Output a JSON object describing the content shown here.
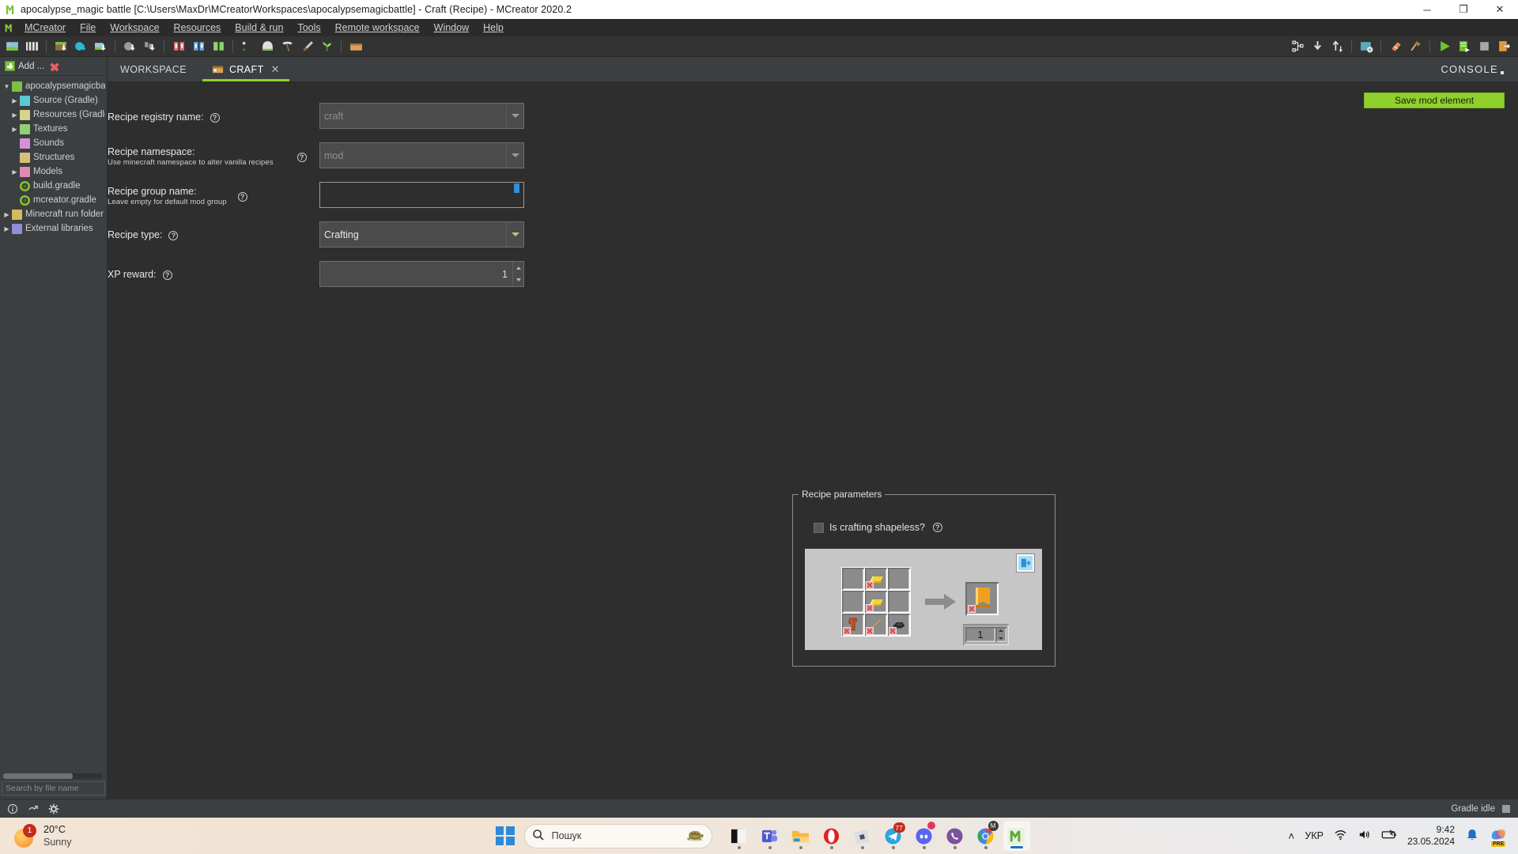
{
  "window": {
    "title": "apocalypse_magic battle [C:\\Users\\MaxDr\\MCreatorWorkspaces\\apocalypsemagicbattle] - Craft (Recipe) - MCreator 2020.2",
    "minimize": "─",
    "maximize": "❐",
    "close": "✕"
  },
  "menubar": {
    "items": [
      {
        "label": "MCreator",
        "mnemonic": "M"
      },
      {
        "label": "File",
        "mnemonic": "F"
      },
      {
        "label": "Workspace",
        "mnemonic": "W"
      },
      {
        "label": "Resources",
        "mnemonic": "R"
      },
      {
        "label": "Build & run",
        "mnemonic": "B"
      },
      {
        "label": "Tools",
        "mnemonic": "T"
      },
      {
        "label": "Remote workspace",
        "mnemonic": "R"
      },
      {
        "label": "Window",
        "mnemonic": "W"
      },
      {
        "label": "Help",
        "mnemonic": "H"
      }
    ]
  },
  "sidebar": {
    "add_label": "Add ...",
    "search_placeholder": "Search by file name",
    "tree": [
      {
        "label": "apocalypsemagicba",
        "depth": 0,
        "expandable": true,
        "expanded": true,
        "icon": "workspace-icon",
        "color": "#7cc242"
      },
      {
        "label": "Source (Gradle)",
        "depth": 1,
        "expandable": true,
        "expanded": false,
        "icon": "folder-source-icon",
        "color": "#5bc8d4"
      },
      {
        "label": "Resources (Gradle)",
        "depth": 1,
        "expandable": true,
        "expanded": false,
        "icon": "folder-resources-icon",
        "color": "#d6d38a"
      },
      {
        "label": "Textures",
        "depth": 1,
        "expandable": true,
        "expanded": false,
        "icon": "folder-textures-icon",
        "color": "#8fd170"
      },
      {
        "label": "Sounds",
        "depth": 1,
        "expandable": false,
        "expanded": false,
        "icon": "folder-sounds-icon",
        "color": "#d98fd6"
      },
      {
        "label": "Structures",
        "depth": 1,
        "expandable": false,
        "expanded": false,
        "icon": "folder-structures-icon",
        "color": "#d6c07a"
      },
      {
        "label": "Models",
        "depth": 1,
        "expandable": true,
        "expanded": false,
        "icon": "folder-models-icon",
        "color": "#e08ab4"
      },
      {
        "label": "build.gradle",
        "depth": 1,
        "expandable": false,
        "expanded": false,
        "icon": "gradle-icon",
        "color": "#8fc22a"
      },
      {
        "label": "mcreator.gradle",
        "depth": 1,
        "expandable": false,
        "expanded": false,
        "icon": "gradle-icon",
        "color": "#8fc22a"
      },
      {
        "label": "Minecraft run folder",
        "depth": 1,
        "expandable": true,
        "expanded": false,
        "icon": "folder-run-icon",
        "color": "#d6b95a"
      },
      {
        "label": "External libraries",
        "depth": 1,
        "expandable": true,
        "expanded": false,
        "icon": "folder-libs-icon",
        "color": "#8f8fd6"
      }
    ]
  },
  "tabs": {
    "items": [
      {
        "label": "WORKSPACE",
        "active": false,
        "closable": false
      },
      {
        "label": "CRAFT",
        "active": true,
        "closable": true,
        "close_glyph": "✕"
      }
    ],
    "console_label": "CONSOLE"
  },
  "main": {
    "save_label": "Save mod element",
    "help_glyph": "?",
    "fields": [
      {
        "name": "recipe-registry-name",
        "label": "Recipe registry name:",
        "sublabel": "",
        "type": "combo",
        "value": "craft",
        "disabled": true
      },
      {
        "name": "recipe-namespace",
        "label": "Recipe namespace:",
        "sublabel": "Use minecraft namespace to alter vanilla recipes",
        "type": "combo",
        "value": "mod",
        "disabled": true
      },
      {
        "name": "recipe-group-name",
        "label": "Recipe group name:",
        "sublabel": "Leave empty for default mod group",
        "type": "text",
        "value": "",
        "disabled": false
      },
      {
        "name": "recipe-type",
        "label": "Recipe type:",
        "sublabel": "",
        "type": "combo",
        "value": "Crafting",
        "disabled": false
      },
      {
        "name": "xp-reward",
        "label": "XP reward:",
        "sublabel": "",
        "type": "spinner",
        "value": "1",
        "disabled": false
      }
    ]
  },
  "recipe_parameters": {
    "group_title": "Recipe parameters",
    "shapeless_label": "Is crafting shapeless?",
    "shapeless_checked": false,
    "help_glyph": "?",
    "output_count": "1",
    "export_icon": "export-icon",
    "grid": [
      {
        "slot": 0,
        "item": "empty",
        "label": ""
      },
      {
        "slot": 1,
        "item": "gold-ingot",
        "label": "Gold Ingot"
      },
      {
        "slot": 2,
        "item": "empty",
        "label": ""
      },
      {
        "slot": 3,
        "item": "empty",
        "label": ""
      },
      {
        "slot": 4,
        "item": "gold-ingot",
        "label": "Gold Ingot"
      },
      {
        "slot": 5,
        "item": "empty",
        "label": ""
      },
      {
        "slot": 6,
        "item": "leather",
        "label": "Leather"
      },
      {
        "slot": 7,
        "item": "stick",
        "label": "Stick"
      },
      {
        "slot": 8,
        "item": "flint",
        "label": "Flint"
      }
    ],
    "output_item": "orange-banner"
  },
  "statusbar": {
    "gradle_status": "Gradle idle",
    "icons": [
      "info-icon",
      "plugin-icon",
      "gear-icon"
    ]
  },
  "taskbar": {
    "weather": {
      "temp": "20°C",
      "condition": "Sunny",
      "badge": "1"
    },
    "search_placeholder": "Пошук",
    "apps": [
      {
        "name": "windows-start",
        "active": false,
        "badge": ""
      },
      {
        "name": "dark-reader-app",
        "active": false,
        "badge": ""
      },
      {
        "name": "teams-app",
        "active": false,
        "badge": ""
      },
      {
        "name": "file-explorer-app",
        "active": false,
        "badge": ""
      },
      {
        "name": "opera-app",
        "active": false,
        "badge": ""
      },
      {
        "name": "roblox-app",
        "active": false,
        "badge": ""
      },
      {
        "name": "telegram-app",
        "active": false,
        "badge": "77"
      },
      {
        "name": "discord-app",
        "active": false,
        "badge": ""
      },
      {
        "name": "viber-app",
        "active": false,
        "badge": ""
      },
      {
        "name": "chrome-app",
        "active": false,
        "badge": "M"
      },
      {
        "name": "mcreator-app",
        "active": true,
        "badge": ""
      }
    ],
    "tray": {
      "overflow": "˄",
      "language": "УКР",
      "time": "9:42",
      "date": "23.05.2024"
    }
  },
  "colors": {
    "accent_green": "#8fd12a",
    "panel_bg": "#3c3f41",
    "content_bg": "#2e2e2e",
    "craft_panel": "#c6c6c6"
  }
}
